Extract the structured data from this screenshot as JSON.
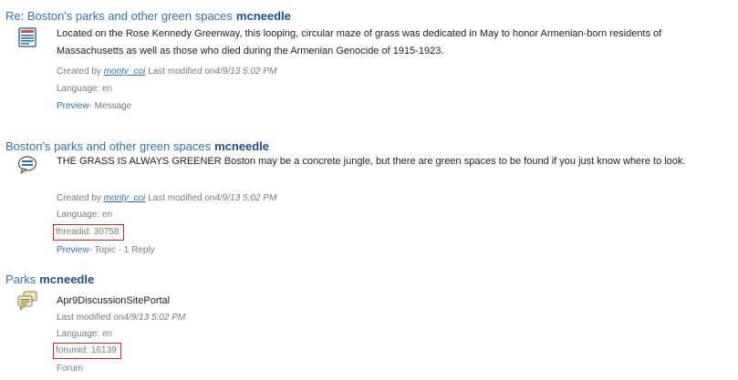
{
  "results": [
    {
      "title": "Re: Boston's parks and other green spaces",
      "query": "mcneedle",
      "icon": "message-icon",
      "snippet": "Located on the Rose Kennedy Greenway, this looping, circular maze of grass was dedicated in May to honor Armenian-born residents of Massachusetts as well as those who died during the Armenian Genocide of 1915-1923.",
      "created_by_label": "Created by",
      "author": "monty_coi",
      "last_modified_label": "Last modified on",
      "modified": "4/9/13 5:02 PM",
      "language": "Language: en",
      "preview_label": "Preview",
      "type_label": "- Message"
    },
    {
      "title": "Boston's parks and other green spaces",
      "query": "mcneedle",
      "icon": "topic-speech-bubble-icon",
      "snippet": "THE GRASS IS ALWAYS GREENER   Boston may be a concrete jungle, but there are green spaces to be found if you just know where to look.",
      "created_by_label": "Created by",
      "author": "monty_coi",
      "last_modified_label": "Last modified on",
      "modified": "4/9/13 5:02 PM",
      "language": "Language: en",
      "id_label": "threadid: 30758",
      "preview_label": "Preview",
      "type_label": "- Topic - 1 Reply"
    },
    {
      "title": "Parks",
      "query": "mcneedle",
      "icon": "forum-speech-bubbles-icon",
      "snippet": "Apr9DiscussionSitePortal",
      "last_modified_label": "Last modified on",
      "modified": "4/9/13 5:02 PM",
      "language": "Language: en",
      "id_label": "forumid: 16139",
      "type_label": "Forum"
    }
  ],
  "colors": {
    "link": "#2e72b8",
    "query": "#1a4f9c",
    "meta": "#7a7a7a",
    "highlight_box": "#d62020"
  }
}
